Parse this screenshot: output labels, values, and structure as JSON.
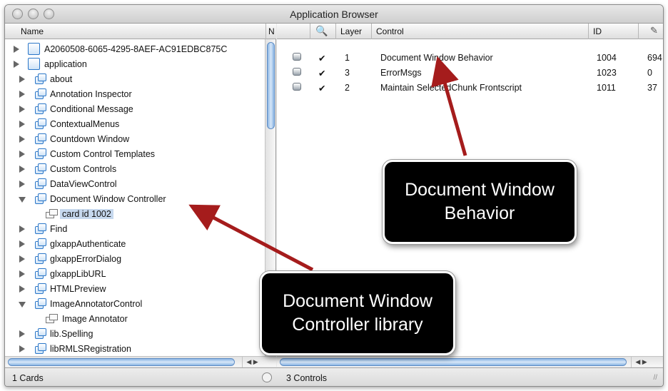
{
  "window": {
    "title": "Application Browser"
  },
  "left_pane": {
    "column_name": "Name",
    "column_truncated": "N",
    "items": [
      {
        "label": "A2060508-6065-4295-8AEF-AC91EDBC875C",
        "kind": "mainstack",
        "expanded": false
      },
      {
        "label": "application",
        "kind": "mainstack",
        "expanded": false
      },
      {
        "label": "about",
        "kind": "stack",
        "expanded": false
      },
      {
        "label": "Annotation Inspector",
        "kind": "stack",
        "expanded": false
      },
      {
        "label": "Conditional Message",
        "kind": "stack",
        "expanded": false
      },
      {
        "label": "ContextualMenus",
        "kind": "stack",
        "expanded": false
      },
      {
        "label": "Countdown Window",
        "kind": "stack",
        "expanded": false
      },
      {
        "label": "Custom Control Templates",
        "kind": "stack",
        "expanded": false
      },
      {
        "label": "Custom Controls",
        "kind": "stack",
        "expanded": false
      },
      {
        "label": "DataViewControl",
        "kind": "stack",
        "expanded": false
      },
      {
        "label": "Document Window Controller",
        "kind": "stack",
        "expanded": true
      },
      {
        "label": "card id 1002",
        "kind": "card",
        "selected": true
      },
      {
        "label": "Find",
        "kind": "stack",
        "expanded": false
      },
      {
        "label": "glxappAuthenticate",
        "kind": "stack",
        "expanded": false
      },
      {
        "label": "glxappErrorDialog",
        "kind": "stack",
        "expanded": false
      },
      {
        "label": "glxappLibURL",
        "kind": "stack",
        "expanded": false
      },
      {
        "label": "HTMLPreview",
        "kind": "stack",
        "expanded": false
      },
      {
        "label": "ImageAnnotatorControl",
        "kind": "stack",
        "expanded": true
      },
      {
        "label": "Image Annotator",
        "kind": "card"
      },
      {
        "label": "lib.Spelling",
        "kind": "stack",
        "expanded": false
      },
      {
        "label": "libRMLSRegistration",
        "kind": "stack",
        "expanded": false
      }
    ],
    "status": "1 Cards"
  },
  "right_pane": {
    "columns": {
      "search_icon": "search-icon",
      "layer": "Layer",
      "control": "Control",
      "id": "ID",
      "extra_icon": "brush-icon"
    },
    "rows": [
      {
        "checked": "✔",
        "layer": "1",
        "control": "Document Window Behavior",
        "id": "1004",
        "extra": "694"
      },
      {
        "checked": "✔",
        "layer": "3",
        "control": "ErrorMsgs",
        "id": "1023",
        "extra": "0"
      },
      {
        "checked": "✔",
        "layer": "2",
        "control": "Maintain SelectedChunk Frontscript",
        "id": "1011",
        "extra": "37"
      }
    ],
    "status": "3 Controls"
  },
  "annotations": {
    "callout_right": {
      "line1": "Document Window",
      "line2": "Behavior"
    },
    "callout_left": {
      "line1": "Document Window",
      "line2": "Controller library"
    },
    "arrow_color": "#a51c1c"
  }
}
